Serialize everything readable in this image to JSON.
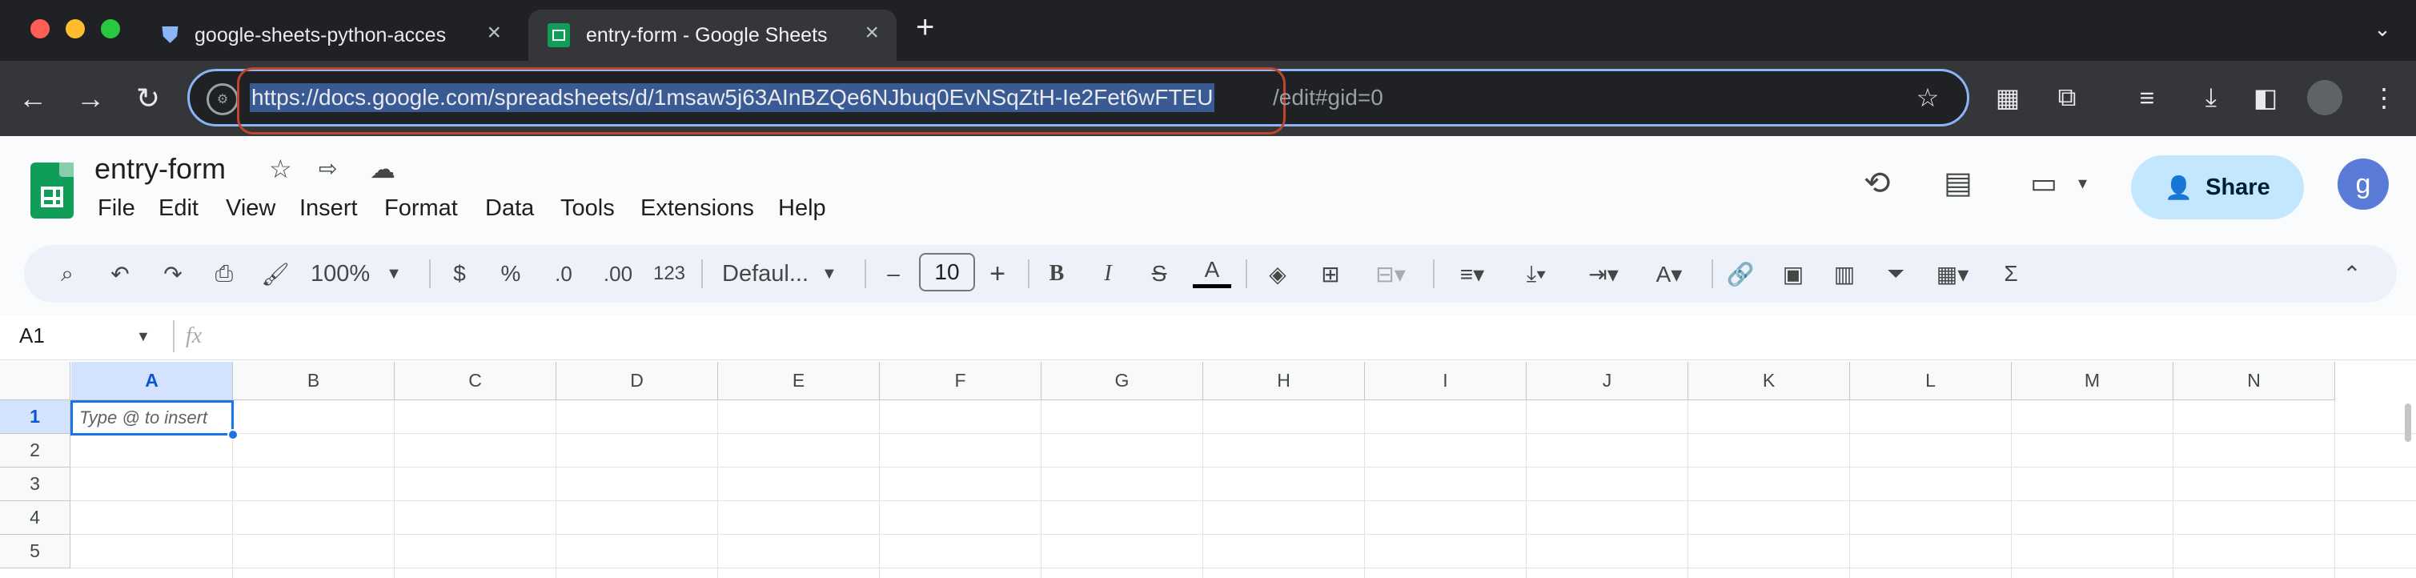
{
  "browser": {
    "tabs": [
      {
        "title": "google-sheets-python-acces",
        "active": false
      },
      {
        "title": "entry-form - Google Sheets",
        "active": true
      }
    ],
    "new_tab": "+",
    "url_selected": "https://docs.google.com/spreadsheets/d/1msaw5j63AInBZQe6NJbuq0EvNSqZtH-Ie2Fet6wFTEU",
    "url_rest": "/edit#gid=0"
  },
  "sheets": {
    "doc_title": "entry-form",
    "menu": [
      "File",
      "Edit",
      "View",
      "Insert",
      "Format",
      "Data",
      "Tools",
      "Extensions",
      "Help"
    ],
    "share_label": "Share",
    "avatar_letter": "g",
    "toolbar": {
      "zoom": "100%",
      "currency": "$",
      "percent": "%",
      "dec_decrease": ".0",
      "dec_increase": ".00",
      "number_format": "123",
      "font": "Defaul...",
      "font_size": "10",
      "minus": "–",
      "plus": "+",
      "bold": "B",
      "italic": "I",
      "strike": "S",
      "text_color": "A"
    },
    "name_box": "A1",
    "fx": "fx",
    "columns": [
      "A",
      "B",
      "C",
      "D",
      "E",
      "F",
      "G",
      "H",
      "I",
      "J",
      "K",
      "L",
      "M",
      "N"
    ],
    "rows": [
      "1",
      "2",
      "3",
      "4",
      "5"
    ],
    "active_cell_placeholder": "Type @ to insert"
  },
  "colors": {
    "accent": "#0b57d0",
    "sheets_green": "#0f9d58",
    "share_bg": "#c2e7ff"
  }
}
